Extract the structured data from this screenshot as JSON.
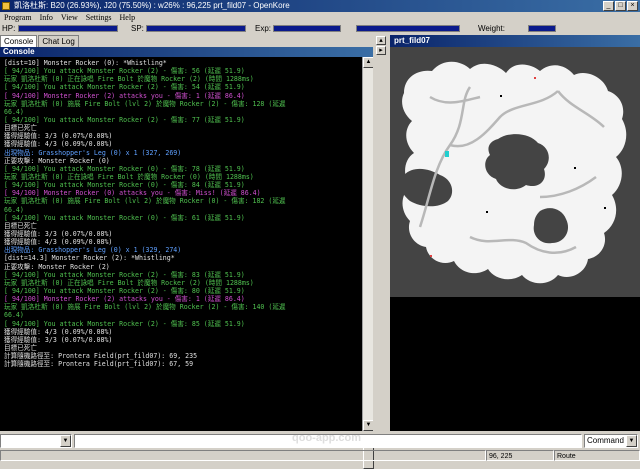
{
  "window": {
    "title": "凱洛杜斯: B20 (26.93%), J20 (75.50%) : w26% : 96,225 prt_fild07 - OpenKore",
    "buttons": {
      "minimize": "_",
      "maximize": "□",
      "close": "×"
    }
  },
  "menu": [
    "Program",
    "Info",
    "View",
    "Settings",
    "Help"
  ],
  "stats": {
    "hp_label": "HP:",
    "sp_label": "SP:",
    "exp_label": "Exp:",
    "weight_label": "Weight:"
  },
  "tabs": [
    "Console",
    "Chat Log"
  ],
  "console_title": "Console",
  "console_lines": [
    {
      "text": "[dist=10] Monster Rocker (0): *Whistling*",
      "color": "#e0e0e0"
    },
    {
      "text": "[ 94/100] You attack Monster Rocker (2) - 傷害: 56 (延遲 51.9)",
      "color": "#4fc04f"
    },
    {
      "text": "玩家 凱洛杜斯 (0) 正在詠唱 Fire Bolt 於魔物 Rocker (2) (時間 1288ms)",
      "color": "#4fc04f"
    },
    {
      "text": "[ 94/100] You attack Monster Rocker (2) - 傷害: 54 (延遲 51.9)",
      "color": "#4fc04f"
    },
    {
      "text": "[ 94/100] Monster Rocker (2) attacks you - 傷害: 1 (延遲 86.4)",
      "color": "#d050d0"
    },
    {
      "text": "玩家 凱洛杜斯 (0) 施展 Fire Bolt (lvl 2) 於魔物 Rocker (2) - 傷害: 128 (延遲",
      "color": "#4fc04f"
    },
    {
      "text": "66.4)",
      "color": "#4fc04f"
    },
    {
      "text": "[ 94/100] You attack Monster Rocker (2) - 傷害: 77 (延遲 51.9)",
      "color": "#4fc04f"
    },
    {
      "text": "目標已死亡",
      "color": "#e0e0e0"
    },
    {
      "text": "獲得經驗值: 3/3 (0.07%/0.08%)",
      "color": "#e0e0e0"
    },
    {
      "text": "獲得經驗值: 4/3 (0.09%/0.08%)",
      "color": "#e0e0e0"
    },
    {
      "text": "出現物品: Grasshopper's Leg (0) x 1 (327, 269)",
      "color": "#5fa0ff"
    },
    {
      "text": "正要攻擊: Monster Rocker (0)",
      "color": "#e0e0e0"
    },
    {
      "text": "[ 94/100] You attack Monster Rocker (0) - 傷害: 78 (延遲 51.9)",
      "color": "#4fc04f"
    },
    {
      "text": "玩家 凱洛杜斯 (0) 正在詠唱 Fire Bolt 於魔物 Rocker (0) (時間 1288ms)",
      "color": "#4fc04f"
    },
    {
      "text": "[ 94/100] You attack Monster Rocker (0) - 傷害: 84 (延遲 51.9)",
      "color": "#4fc04f"
    },
    {
      "text": "[ 94/100] Monster Rocker (0) attacks you - 傷害: Miss! (延遲 86.4)",
      "color": "#d050d0"
    },
    {
      "text": "玩家 凱洛杜斯 (0) 施展 Fire Bolt (lvl 2) 於魔物 Rocker (0) - 傷害: 182 (延遲",
      "color": "#4fc04f"
    },
    {
      "text": "66.4)",
      "color": "#4fc04f"
    },
    {
      "text": "[ 94/100] You attack Monster Rocker (0) - 傷害: 61 (延遲 51.9)",
      "color": "#4fc04f"
    },
    {
      "text": "目標已死亡",
      "color": "#e0e0e0"
    },
    {
      "text": "獲得經驗值: 3/3 (0.07%/0.08%)",
      "color": "#e0e0e0"
    },
    {
      "text": "獲得經驗值: 4/3 (0.09%/0.08%)",
      "color": "#e0e0e0"
    },
    {
      "text": "出現物品: Grasshopper's Leg (0) x 1 (329, 274)",
      "color": "#5fa0ff"
    },
    {
      "text": "[dist=14.3] Monster Rocker (2): *Whistling*",
      "color": "#e0e0e0"
    },
    {
      "text": "正要攻擊: Monster Rocker (2)",
      "color": "#e0e0e0"
    },
    {
      "text": "[ 94/100] You attack Monster Rocker (2) - 傷害: 83 (延遲 51.9)",
      "color": "#4fc04f"
    },
    {
      "text": "玩家 凱洛杜斯 (0) 正在詠唱 Fire Bolt 於魔物 Rocker (2) (時間 1288ms)",
      "color": "#4fc04f"
    },
    {
      "text": "[ 94/100] You attack Monster Rocker (2) - 傷害: 80 (延遲 51.9)",
      "color": "#4fc04f"
    },
    {
      "text": "[ 94/100] Monster Rocker (2) attacks you - 傷害: 1 (延遲 86.4)",
      "color": "#d050d0"
    },
    {
      "text": "玩家 凱洛杜斯 (0) 施展 Fire Bolt (lvl 2) 於魔物 Rocker (2) - 傷害: 140 (延遲",
      "color": "#4fc04f"
    },
    {
      "text": "66.4)",
      "color": "#4fc04f"
    },
    {
      "text": "[ 94/100] You attack Monster Rocker (2) - 傷害: 85 (延遲 51.9)",
      "color": "#4fc04f"
    },
    {
      "text": "獲得經驗值: 4/3 (0.09%/0.08%)",
      "color": "#e0e0e0"
    },
    {
      "text": "獲得經驗值: 3/3 (0.07%/0.08%)",
      "color": "#e0e0e0"
    },
    {
      "text": "目標已死亡",
      "color": "#e0e0e0"
    },
    {
      "text": "計算隨機路徑至: Prontera Field(prt_fild07): 69, 235",
      "color": "#e0e0e0"
    },
    {
      "text": "計算隨機路徑至: Prontera Field(prt_fild07): 67, 59",
      "color": "#e0e0e0"
    }
  ],
  "map_title": "prt_fild07",
  "bottom": {
    "command_label": "Command"
  },
  "status": {
    "coords": "96, 225",
    "state": "Route"
  },
  "watermark": "qoo-app.com"
}
